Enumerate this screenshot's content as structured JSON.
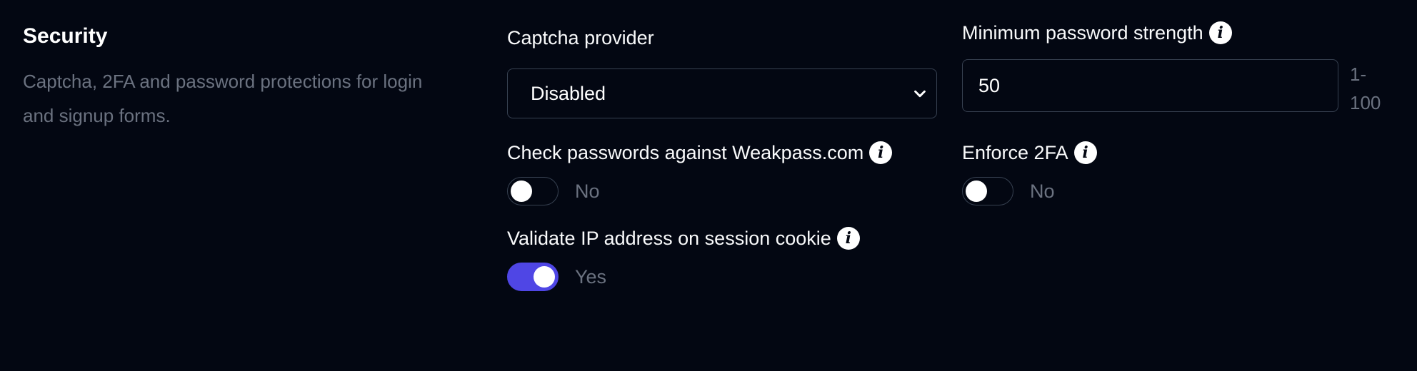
{
  "section": {
    "title": "Security",
    "description": "Captcha, 2FA and password protections for login and signup forms."
  },
  "captcha": {
    "label": "Captcha provider",
    "selected": "Disabled"
  },
  "min_password_strength": {
    "label": "Minimum password strength",
    "value": "50",
    "range_hint": "1-100"
  },
  "weakpass": {
    "label": "Check passwords against Weakpass.com",
    "enabled": false,
    "state_label": "No"
  },
  "enforce_2fa": {
    "label": "Enforce 2FA",
    "enabled": false,
    "state_label": "No"
  },
  "validate_ip": {
    "label": "Validate IP address on session cookie",
    "enabled": true,
    "state_label": "Yes"
  },
  "colors": {
    "background": "#030712",
    "accent": "#4f46e5",
    "muted_text": "#6b7280",
    "border": "#374151"
  },
  "icons": {
    "info": "info-icon",
    "select_arrow": "chevron-down-icon"
  }
}
